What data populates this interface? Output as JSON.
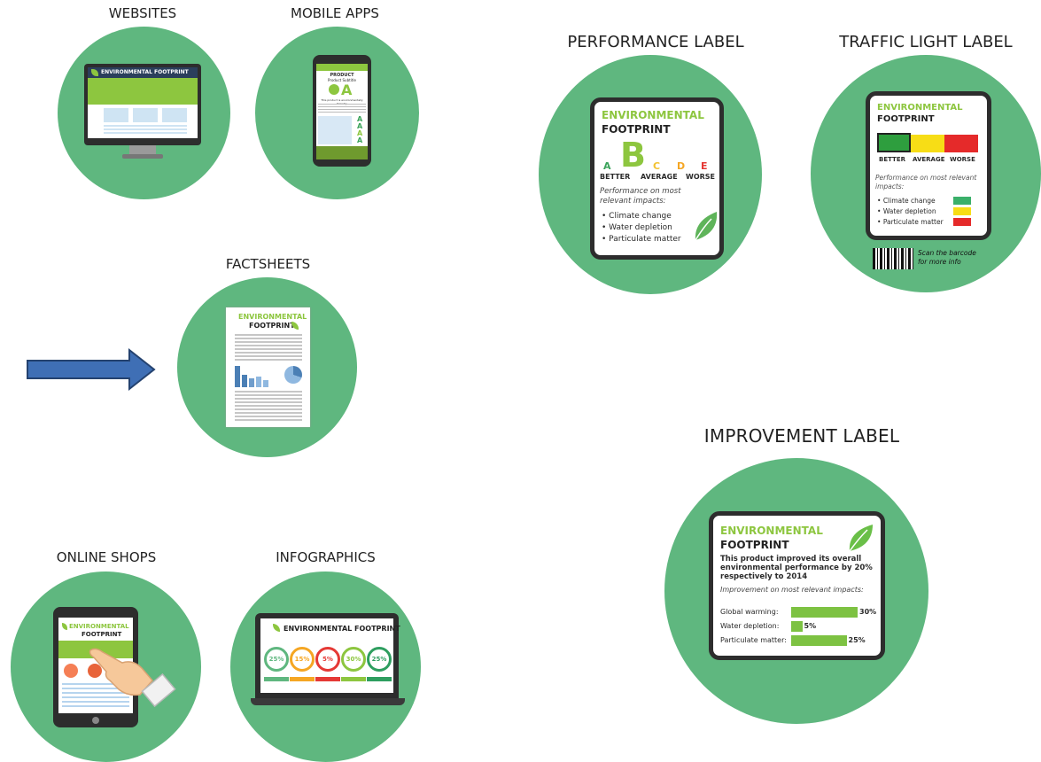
{
  "websites": {
    "title": "WEBSITES",
    "brand": "ENVIRONMENTAL FOOTPRINT"
  },
  "mobile": {
    "title": "MOBILE APPS",
    "product": "PRODUCT",
    "product_sub": "Product Subtitle",
    "grade": "A",
    "tagline": "This product is environmentally friendly",
    "side_grades": [
      "A",
      "A",
      "A",
      "A"
    ]
  },
  "factsheets": {
    "title": "FACTSHEETS",
    "brand_line1": "ENVIRONMENTAL",
    "brand_line2": "FOOTPRINT"
  },
  "online": {
    "title": "ONLINE SHOPS",
    "brand_line1": "ENVIRONMENTAL",
    "brand_line2": "FOOTPRINT"
  },
  "infographics": {
    "title": "INFOGRAPHICS",
    "brand": "ENVIRONMENTAL FOOTPRINT",
    "rings": [
      {
        "value": "25%",
        "color": "#5fb77f"
      },
      {
        "value": "15%",
        "color": "#f5a623"
      },
      {
        "value": "5%",
        "color": "#e53935"
      },
      {
        "value": "30%",
        "color": "#8dc63f"
      },
      {
        "value": "25%",
        "color": "#2e9e5f"
      }
    ]
  },
  "performance": {
    "title": "PERFORMANCE LABEL",
    "brand_line1": "ENVIRONMENTAL",
    "brand_line2": "FOOTPRINT",
    "grades": [
      {
        "letter": "A",
        "color": "#3aa35a"
      },
      {
        "letter": "B",
        "color": "#8dc63f"
      },
      {
        "letter": "C",
        "color": "#f2c230"
      },
      {
        "letter": "D",
        "color": "#f5a623"
      },
      {
        "letter": "E",
        "color": "#e53935"
      }
    ],
    "scale": [
      "BETTER",
      "AVERAGE",
      "WORSE"
    ],
    "subtitle": "Performance on most relevant impacts:",
    "impacts": [
      "Climate change",
      "Water depletion",
      "Particulate matter"
    ]
  },
  "traffic": {
    "title": "TRAFFIC LIGHT LABEL",
    "brand_line1": "ENVIRONMENTAL",
    "brand_line2": "FOOTPRINT",
    "scale": [
      "BETTER",
      "AVERAGE",
      "WORSE"
    ],
    "scale_colors": [
      "#2e9e3e",
      "#f7dd16",
      "#e52a2a"
    ],
    "subtitle": "Performance on most relevant impacts:",
    "impacts": [
      {
        "label": "Climate change",
        "color": "#3ab06a"
      },
      {
        "label": "Water depletion",
        "color": "#f7dd16"
      },
      {
        "label": "Particulate matter",
        "color": "#e52a2a"
      }
    ],
    "barcode_note": "Scan the barcode for more info"
  },
  "improvement": {
    "title": "IMPROVEMENT LABEL",
    "brand_line1": "ENVIRONMENTAL",
    "brand_line2": "FOOTPRINT",
    "statement": "This product improved its overall environmental performance by 20% respectively to 2014",
    "subtitle": "Improvement on most relevant impacts:",
    "bars": [
      {
        "label": "Global warming:",
        "value": "30%",
        "fraction": 0.3
      },
      {
        "label": "Water depletion:",
        "value": "5%",
        "fraction": 0.05
      },
      {
        "label": "Particulate matter:",
        "value": "25%",
        "fraction": 0.25
      }
    ]
  }
}
